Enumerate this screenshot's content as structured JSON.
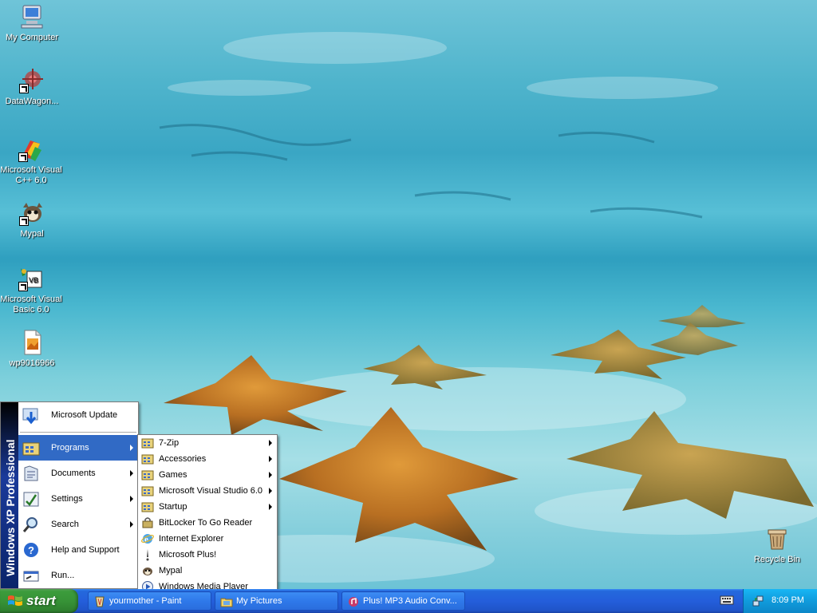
{
  "desktop": {
    "icons": [
      {
        "label": "My Computer"
      },
      {
        "label": "DataWagon..."
      },
      {
        "label": "Microsoft Visual C++ 6.0"
      },
      {
        "label": "Mypal"
      },
      {
        "label": "Microsoft Visual Basic 6.0"
      },
      {
        "label": "wp9016966"
      },
      {
        "label": "Recycle Bin"
      }
    ]
  },
  "start_menu": {
    "banner_brand": "Windows XP",
    "banner_edition": "Professional",
    "items": [
      {
        "label": "Microsoft Update",
        "icon": "update-icon"
      },
      {
        "label": "Programs",
        "icon": "programs-icon",
        "has_submenu": true
      },
      {
        "label": "Documents",
        "icon": "documents-icon",
        "has_submenu": true
      },
      {
        "label": "Settings",
        "icon": "settings-icon",
        "has_submenu": true
      },
      {
        "label": "Search",
        "icon": "search-icon",
        "has_submenu": true
      },
      {
        "label": "Help and Support",
        "icon": "help-icon"
      },
      {
        "label": "Run...",
        "icon": "run-icon"
      }
    ]
  },
  "programs_menu": {
    "items": [
      {
        "label": "7-Zip",
        "has_submenu": true
      },
      {
        "label": "Accessories",
        "has_submenu": true
      },
      {
        "label": "Games",
        "has_submenu": true
      },
      {
        "label": "Microsoft Visual Studio 6.0",
        "has_submenu": true
      },
      {
        "label": "Startup",
        "has_submenu": true
      },
      {
        "label": "BitLocker To Go Reader"
      },
      {
        "label": "Internet Explorer"
      },
      {
        "label": "Microsoft Plus!"
      },
      {
        "label": "Mypal"
      },
      {
        "label": "Windows Media Player"
      }
    ]
  },
  "taskbar": {
    "start_label": "start",
    "tasks": [
      {
        "label": "yourmother - Paint"
      },
      {
        "label": "My Pictures"
      },
      {
        "label": "Plus! MP3 Audio Conv..."
      }
    ],
    "clock": "8:09 PM"
  },
  "colors": {
    "taskbar_blue": "#245edb",
    "start_green": "#379337",
    "menu_highlight": "#316ac5"
  }
}
